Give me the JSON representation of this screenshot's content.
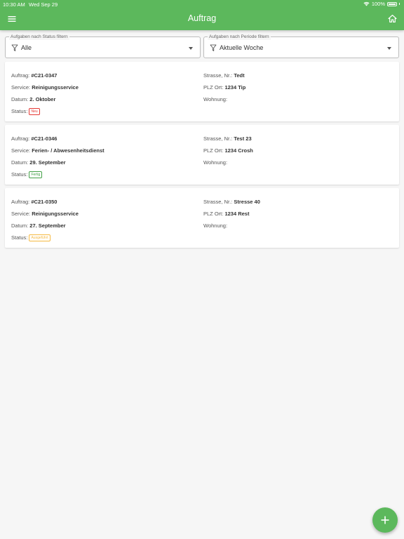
{
  "statusbar": {
    "time": "10:30 AM",
    "date": "Wed Sep 29",
    "battery": "100%"
  },
  "header": {
    "title": "Auftrag",
    "menu_icon": "menu-icon",
    "home_icon": "home-icon"
  },
  "filters": {
    "status": {
      "label": "Aufgaben nach Status filtern",
      "value": "Alle"
    },
    "period": {
      "label": "Aufgaben nach Periode filtern",
      "value": "Aktuelle Woche"
    }
  },
  "labels": {
    "order": "Auftrag:",
    "service": "Service:",
    "date": "Datum:",
    "status": "Status:",
    "street": "Strasse, Nr.:",
    "zip_city": "PLZ Ort:",
    "apartment": "Wohnung:"
  },
  "orders": [
    {
      "id": "#C21-0347",
      "service": "Reinigungsservice",
      "date": "2. Oktober",
      "status": "Neu",
      "status_color": "#e53935",
      "street": "Tedt",
      "zip_city": "1234 Tip",
      "apartment": ""
    },
    {
      "id": "#C21-0346",
      "service": "Ferien- / Abwesenheitsdienst",
      "date": "29. September",
      "status": "Fertig",
      "status_color": "#43a047",
      "street": "Test 23",
      "zip_city": "1234 Crosh",
      "apartment": ""
    },
    {
      "id": "#C21-0350",
      "service": "Reinigungsservice",
      "date": "27. September",
      "status": "Ausgeführt",
      "status_color": "#f5b942",
      "street": "Stresse 40",
      "zip_city": "1234 Rest",
      "apartment": ""
    }
  ],
  "fab": {
    "icon": "plus-icon"
  },
  "colors": {
    "primary": "#5cb85c",
    "background": "#f6f6f6"
  }
}
